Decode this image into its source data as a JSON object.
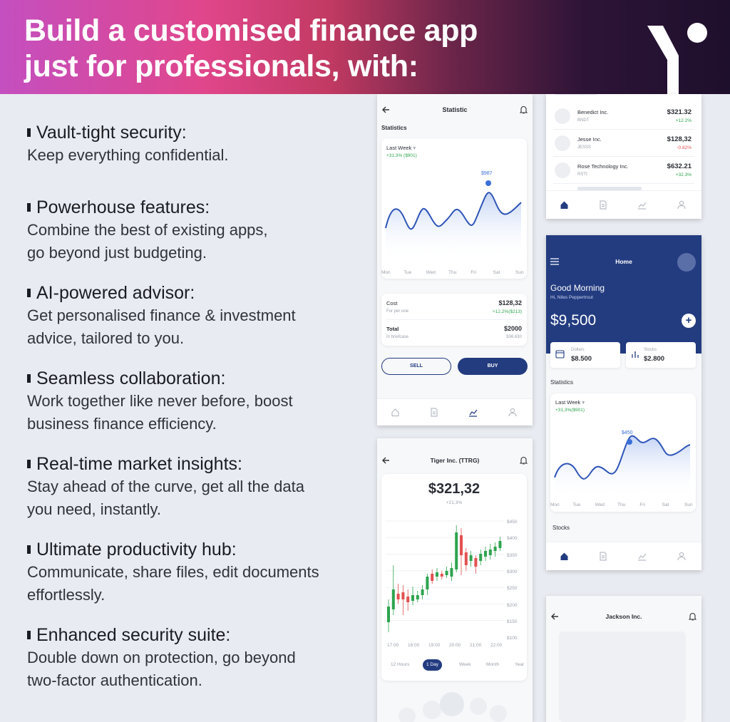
{
  "header": {
    "headline_line1": "Build a customised finance app",
    "headline_line2": "just for professionals, with:"
  },
  "features": [
    {
      "title": "Vault-tight security:",
      "desc": [
        "Keep everything confidential."
      ]
    },
    {
      "title": "Powerhouse features:",
      "desc": [
        "Combine the best of existing apps,",
        "go beyond just budgeting."
      ]
    },
    {
      "title": "AI-powered advisor:",
      "desc": [
        "Get personalised finance & investment",
        "advice, tailored to you."
      ]
    },
    {
      "title": "Seamless collaboration:",
      "desc": [
        "Work together like never before, boost",
        "business finance efficiency."
      ]
    },
    {
      "title": "Real-time market insights:",
      "desc": [
        "Stay ahead of the curve, get all the data",
        "you need, instantly."
      ]
    },
    {
      "title": "Ultimate productivity hub:",
      "desc": [
        "Communicate, share files, edit documents",
        "effortlessly."
      ]
    },
    {
      "title": "Enhanced security suite:",
      "desc": [
        "Double down on protection, go beyond",
        "two-factor authentication."
      ]
    }
  ],
  "statistic_screen": {
    "title": "Statistic",
    "section": "Statistics",
    "period": "Last Week",
    "change": "+31,3% ($901)",
    "peak_label": "$987",
    "days": [
      "Mon",
      "Tue",
      "Wed",
      "Thu",
      "Fri",
      "Sat",
      "Sun"
    ],
    "cost_label": "Cost",
    "cost_value": "$128,32",
    "cost_sub": "For per one",
    "cost_change": "+12,2%($213)",
    "total_label": "Total",
    "total_value": "$2000",
    "total_sub": "In briefcase",
    "total_sub_value": "$36,630",
    "sell": "SELL",
    "buy": "BUY"
  },
  "stock_list": {
    "items": [
      {
        "name": "Benedict Inc.",
        "ticker": "BNDT",
        "price": "$321.32",
        "change": "+12.2%",
        "dir": "pos"
      },
      {
        "name": "Jesse Inc.",
        "ticker": "JESSS",
        "price": "$128,32",
        "change": "-0.82%",
        "dir": "neg"
      },
      {
        "name": "Rose Technology Inc.",
        "ticker": "RSTI",
        "price": "$632.21",
        "change": "+32.3%",
        "dir": "pos"
      }
    ]
  },
  "home_screen": {
    "title": "Home",
    "greeting": "Good Morning",
    "user": "Hi, Niles Peppertrout",
    "balance": "$9,500",
    "dollars_label": "Dollars",
    "dollars_value": "$8.500",
    "stocks_label": "Stocks",
    "stocks_value": "$2.800",
    "section": "Statistics",
    "period": "Last Week",
    "change": "+31,3%($901)",
    "peak_label": "$450",
    "days": [
      "Mon",
      "Tue",
      "Wed",
      "Thu",
      "Fri",
      "Sat",
      "Sun"
    ],
    "stocks_heading": "Stocks"
  },
  "tiger_screen": {
    "title": "Tiger Inc. (TTRG)",
    "price": "$321,32",
    "change": "+21,3%",
    "y_ticks": [
      "$450",
      "$400",
      "$350",
      "$300",
      "$250",
      "$200",
      "$150",
      "$100"
    ],
    "x_ticks": [
      "17:00",
      "18:00",
      "19:00",
      "20:00",
      "21:00",
      "22:00"
    ],
    "ranges": [
      "12 Hours",
      "1 Day",
      "Week",
      "Month",
      "Year"
    ],
    "active_range": "1 Day"
  },
  "jackson_screen": {
    "title": "Jackson Inc."
  },
  "colors": {
    "navy": "#233c80",
    "positive": "#2ea44f",
    "negative": "#e35050",
    "accent_blue": "#3a6fd8"
  }
}
